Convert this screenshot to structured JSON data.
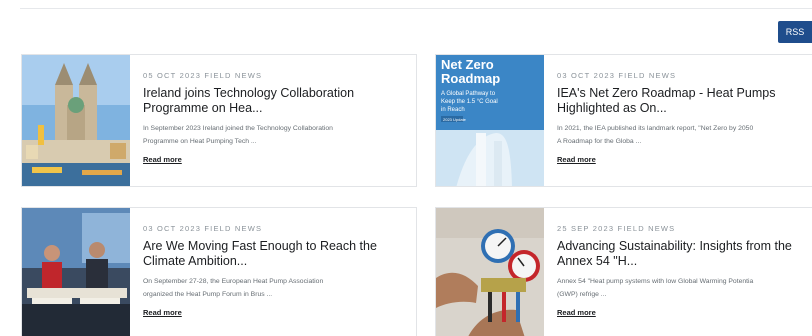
{
  "toolbar": {
    "rss_label": "RSS"
  },
  "articles": [
    {
      "date_category": "05 OCT 2023 FIELD NEWS",
      "title": "Ireland joins Technology Collaboration Programme on Hea...",
      "excerpt_line1": "In September 2023 Ireland joined the Technology Collaboration",
      "excerpt_line2": "Programme on Heat Pumping Tech ...",
      "read_more": "Read more",
      "image_icon": "church-town-photo"
    },
    {
      "date_category": "03 OCT 2023 FIELD NEWS",
      "title": "IEA's Net Zero Roadmap - Heat Pumps Highlighted as On...",
      "excerpt_line1": "In 2021, the IEA published its landmark report, \"Net Zero by 2050",
      "excerpt_line2": "A Roadmap for the Globa ...",
      "read_more": "Read more",
      "image_icon": "report-cover-image",
      "cover_title_line1": "Net Zero",
      "cover_title_line2": "Roadmap",
      "cover_sub_line1": "A Global Pathway to",
      "cover_sub_line2": "Keep the 1.5 °C Goal",
      "cover_sub_line3": "in Reach",
      "cover_badge": "2023 Update"
    },
    {
      "date_category": "03 OCT 2023 FIELD NEWS",
      "title": "Are We Moving Fast Enough to Reach the Climate Ambition...",
      "excerpt_line1": "On September 27-28, the European Heat Pump Association",
      "excerpt_line2": "organized the Heat Pump Forum in Brus ...",
      "read_more": "Read more",
      "image_icon": "panel-speakers-photo"
    },
    {
      "date_category": "25 SEP 2023 FIELD NEWS",
      "title": "Advancing Sustainability: Insights from the Annex 54 \"H...",
      "excerpt_line1": "Annex 54 \"Heat pump systems with low Global Warming Potentia",
      "excerpt_line2": "(GWP) refrige ...",
      "read_more": "Read more",
      "image_icon": "manifold-gauges-photo"
    }
  ],
  "colors": {
    "accent": "#1f4d8c",
    "cover_bg": "#3b86c6"
  }
}
